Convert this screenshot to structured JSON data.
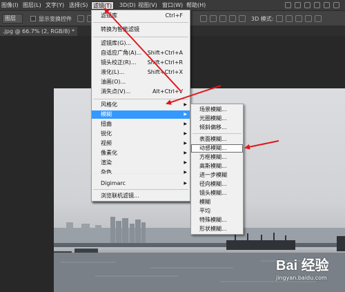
{
  "menubar": {
    "items": [
      "图像(I)",
      "图层(L)",
      "文字(Y)",
      "选择(S)",
      "滤镜(T)",
      "3D(D)",
      "视图(V)",
      "窗口(W)",
      "帮助(H)"
    ]
  },
  "options": {
    "select_value": "图层",
    "checkbox_label": "显示变换控件",
    "mode_3d": "3D 模式:"
  },
  "document": {
    "tab": ".jpg @ 66.7% (2, RGB/8) *"
  },
  "filter_menu": {
    "items": [
      {
        "label": "滤镜库",
        "shortcut": "Ctrl+F"
      },
      {
        "label": "转换为智能滤镜"
      },
      {
        "label": "滤镜库(G)..."
      },
      {
        "label": "自适应广角(A)...",
        "shortcut": "Shift+Ctrl+A"
      },
      {
        "label": "镜头校正(R)...",
        "shortcut": "Shift+Ctrl+R"
      },
      {
        "label": "液化(L)...",
        "shortcut": "Shift+Ctrl+X"
      },
      {
        "label": "油画(O)..."
      },
      {
        "label": "消失点(V)...",
        "shortcut": "Alt+Ctrl+V"
      },
      {
        "label": "风格化"
      },
      {
        "label": "模糊"
      },
      {
        "label": "扭曲"
      },
      {
        "label": "锐化"
      },
      {
        "label": "视频"
      },
      {
        "label": "像素化"
      },
      {
        "label": "渲染"
      },
      {
        "label": "杂色"
      },
      {
        "label": "其它"
      },
      {
        "label": "Digimarc"
      },
      {
        "label": "浏览联机滤镜..."
      }
    ]
  },
  "blur_submenu": {
    "items": [
      "场景模糊...",
      "光圈模糊...",
      "倾斜偏移...",
      "表面模糊...",
      "动感模糊...",
      "方框模糊...",
      "高斯模糊...",
      "进一步模糊",
      "径向模糊...",
      "镜头模糊...",
      "模糊",
      "平均",
      "特殊模糊...",
      "形状模糊..."
    ]
  },
  "watermark": {
    "logo": "Bai 经验",
    "url": "jingyan.baidu.com"
  },
  "colors": {
    "highlight": "#3399ff",
    "arrow": "#e0161b",
    "menu_bg": "#f0f0f0"
  }
}
